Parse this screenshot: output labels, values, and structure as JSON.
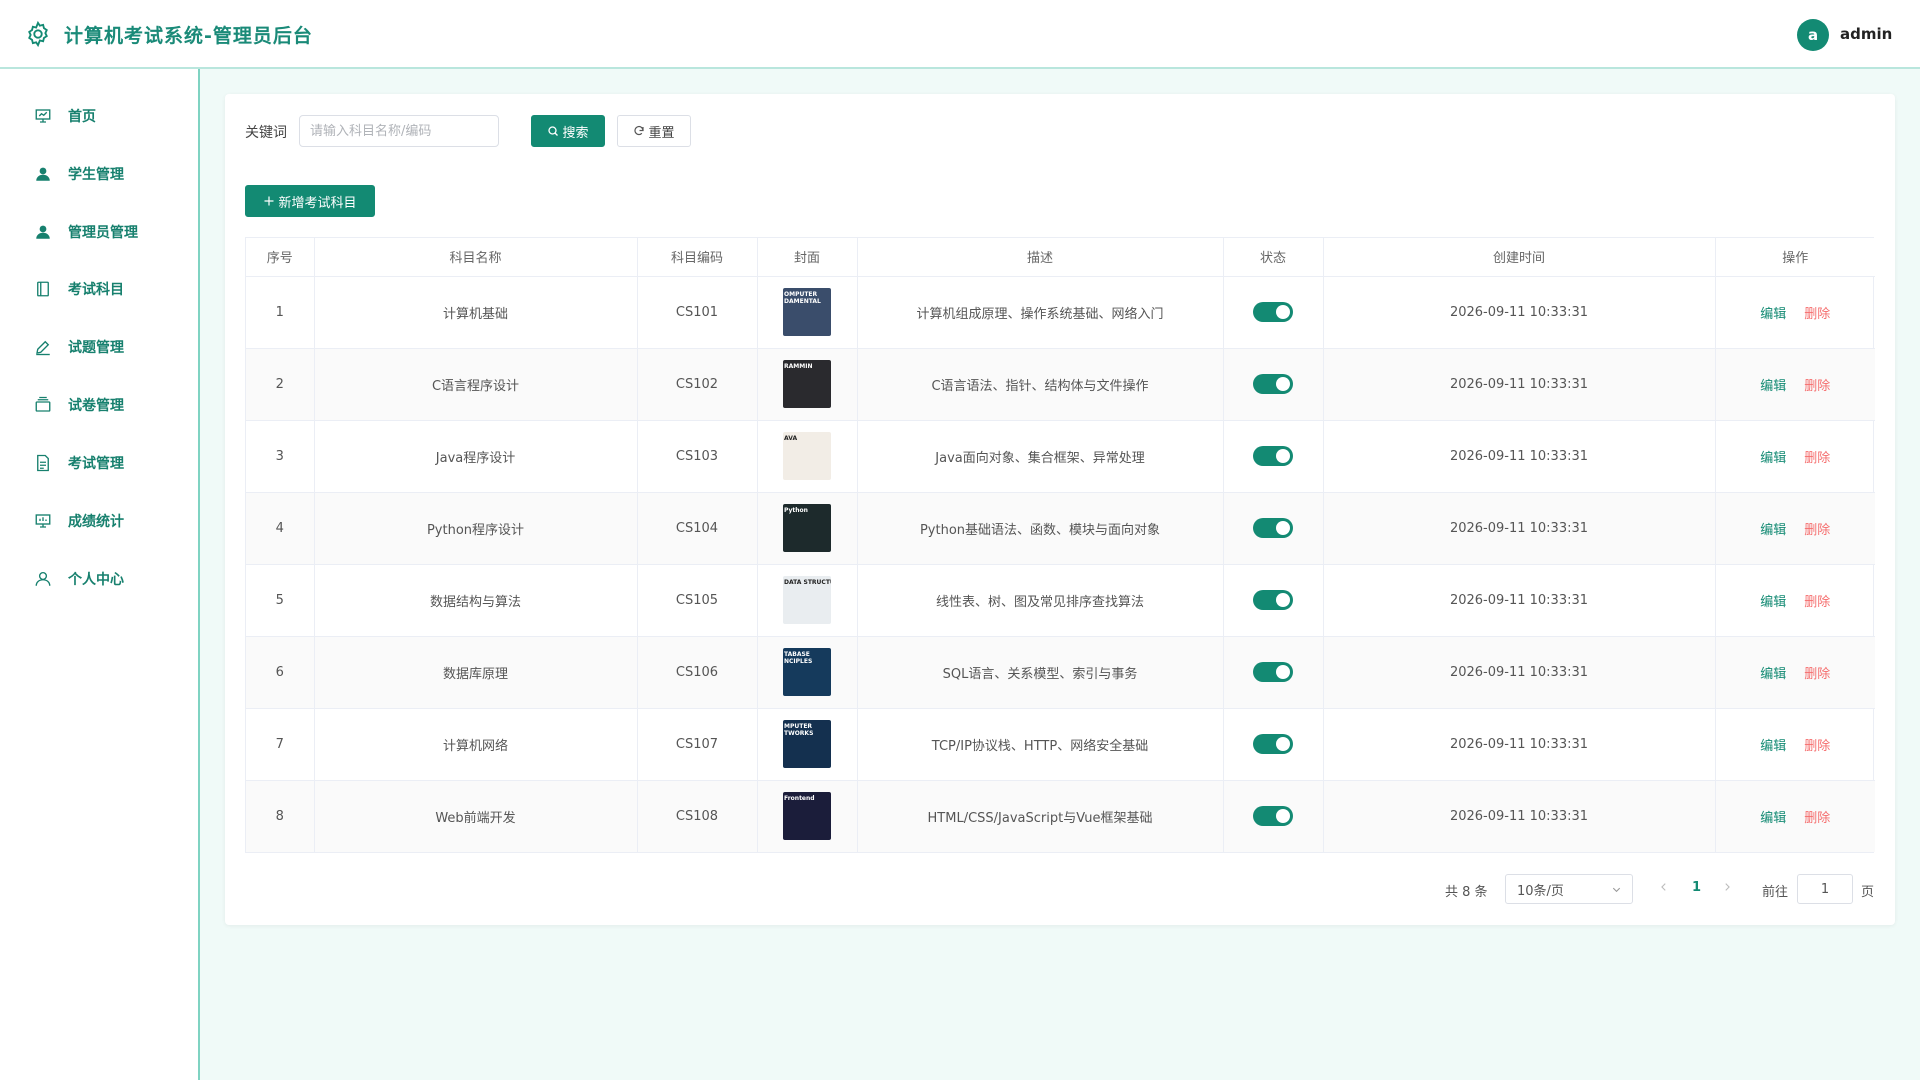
{
  "header": {
    "title": "计算机考试系统-管理员后台",
    "avatar_letter": "a",
    "username": "admin"
  },
  "sidebar": {
    "items": [
      {
        "label": "首页",
        "icon": "presentation-chart-icon"
      },
      {
        "label": "学生管理",
        "icon": "user-filled-icon"
      },
      {
        "label": "管理员管理",
        "icon": "user-filled-icon"
      },
      {
        "label": "考试科目",
        "icon": "notebook-icon"
      },
      {
        "label": "试题管理",
        "icon": "edit-pen-icon"
      },
      {
        "label": "试卷管理",
        "icon": "files-icon"
      },
      {
        "label": "考试管理",
        "icon": "document-icon"
      },
      {
        "label": "成绩统计",
        "icon": "data-board-icon"
      },
      {
        "label": "个人中心",
        "icon": "user-outline-icon"
      }
    ]
  },
  "search": {
    "label": "关键词",
    "placeholder": "请输入科目名称/编码",
    "value": "",
    "search_button": "搜索",
    "reset_button": "重置"
  },
  "toolbar": {
    "add_button": "新增考试科目"
  },
  "table": {
    "columns": [
      "序号",
      "科目名称",
      "科目编码",
      "封面",
      "描述",
      "状态",
      "创建时间",
      "操作"
    ],
    "rows": [
      {
        "index": "1",
        "name": "计算机基础",
        "code": "CS101",
        "cover_text": "OMPUTER\nDAMENTAL",
        "cover_color": "#3a4d6b",
        "desc": "计算机组成原理、操作系统基础、网络入门",
        "enabled": true,
        "created": "2026-09-11 10:33:31"
      },
      {
        "index": "2",
        "name": "C语言程序设计",
        "code": "CS102",
        "cover_text": "RAMMIN",
        "cover_color": "#2a2a2e",
        "desc": "C语言语法、指针、结构体与文件操作",
        "enabled": true,
        "created": "2026-09-11 10:33:31"
      },
      {
        "index": "3",
        "name": "Java程序设计",
        "code": "CS103",
        "cover_text": "AVA",
        "cover_color": "#f2ede6",
        "desc": "Java面向对象、集合框架、异常处理",
        "enabled": true,
        "created": "2026-09-11 10:33:31"
      },
      {
        "index": "4",
        "name": "Python程序设计",
        "code": "CS104",
        "cover_text": "Python",
        "cover_color": "#1d2a2c",
        "desc": "Python基础语法、函数、模块与面向对象",
        "enabled": true,
        "created": "2026-09-11 10:33:31"
      },
      {
        "index": "5",
        "name": "数据结构与算法",
        "code": "CS105",
        "cover_text": "DATA STRUCTURES",
        "cover_color": "#e9edf0",
        "desc": "线性表、树、图及常见排序查找算法",
        "enabled": true,
        "created": "2026-09-11 10:33:31"
      },
      {
        "index": "6",
        "name": "数据库原理",
        "code": "CS106",
        "cover_text": "TABASE\nNCIPLES",
        "cover_color": "#153a5c",
        "desc": "SQL语言、关系模型、索引与事务",
        "enabled": true,
        "created": "2026-09-11 10:33:31"
      },
      {
        "index": "7",
        "name": "计算机网络",
        "code": "CS107",
        "cover_text": "MPUTER\nTWORKS",
        "cover_color": "#14304f",
        "desc": "TCP/IP协议栈、HTTP、网络安全基础",
        "enabled": true,
        "created": "2026-09-11 10:33:31"
      },
      {
        "index": "8",
        "name": "Web前端开发",
        "code": "CS108",
        "cover_text": "Frontend",
        "cover_color": "#1b1d3a",
        "desc": "HTML/CSS/JavaScript与Vue框架基础",
        "enabled": true,
        "created": "2026-09-11 10:33:31"
      }
    ],
    "edit_label": "编辑",
    "delete_label": "删除"
  },
  "pagination": {
    "total_text": "共 8 条",
    "page_size": "10条/页",
    "current_page": "1",
    "goto_label": "前往",
    "goto_value": "1",
    "page_suffix": "页"
  },
  "colors": {
    "primary": "#138a73",
    "danger": "#f56c6c",
    "sidebar_border": "#7fd3c2",
    "background": "#f0faf8"
  }
}
